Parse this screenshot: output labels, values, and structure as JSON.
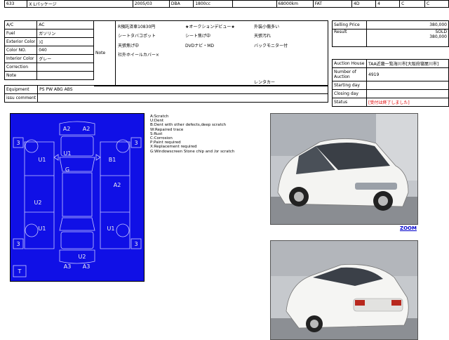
{
  "top_row": [
    "633",
    "X Lパッケージ",
    "2005/03",
    "DBA",
    "1800cc",
    "68000km",
    "FAT",
    "4D",
    "4",
    "C",
    "C"
  ],
  "spec_table": [
    {
      "label": "A/C",
      "value": "AC"
    },
    {
      "label": "Fuel",
      "value": "ガソリン"
    },
    {
      "label": "Exterior Color",
      "value": "ｼﾛ"
    },
    {
      "label": "Color NO.",
      "value": "040"
    },
    {
      "label": "Interior Color",
      "value": "グレー"
    },
    {
      "label": "Correction",
      "value": ""
    },
    {
      "label": "Note",
      "value": ""
    }
  ],
  "note_label": "Note",
  "note_items": [
    "R預託済車10830円",
    "★オークションデビュー★",
    "外装小傷多い",
    "シートタバコポット",
    "シート焦げ中",
    "天張汚れ",
    "天張焦げ中",
    "DVDナビ・MD",
    "バックモニター付",
    "社外ホイールカバー×"
  ],
  "note_extra": "レンタカー",
  "equipment": {
    "label": "Equipment",
    "value": "PS PW ABG ABS"
  },
  "issue_comment": {
    "label": "issu comment",
    "value": ""
  },
  "sale_info": {
    "selling_label": "Selling Price",
    "selling_value": "380,000",
    "result_label": "Result",
    "result_value": "SOLD",
    "result_price": "380,000"
  },
  "auction_info": [
    {
      "label": "Auction House",
      "value": "TAA近畿一覧海川市[大阪府寝屋川市]"
    },
    {
      "label": "Number of Auction",
      "value": "4919"
    },
    {
      "label": "Starting day",
      "value": ""
    },
    {
      "label": "Closing day",
      "value": ""
    },
    {
      "label": "Status",
      "value": "[受付は終了しました]"
    }
  ],
  "damage_labels": {
    "a2_left": "A2",
    "a2_right": "A2",
    "u1_top": "U1",
    "u1_left": "U1",
    "b1_right": "B1",
    "g_center": "G",
    "a2_side": "A2",
    "u2_left": "U2",
    "u1_bottom_left": "U1",
    "u1_bottom_right": "U1",
    "u2_bottom": "U2",
    "a3_left": "A3",
    "a3_right": "A3",
    "n3_tl": "3",
    "n3_tr": "3",
    "n3_bl": "3",
    "n3_br": "3",
    "t_box": "T"
  },
  "legend": [
    "A:Scratch",
    "U:Dent",
    "B:Dent with other defects,deep scratch",
    "W:Repaired trace",
    "S:Rust",
    "C:Corrosion",
    "P:Paint required",
    "X:Replacement required",
    "G:Windowscreen Stone chip and /or scratch"
  ],
  "zoom_label": "ZOOM",
  "colors": {
    "sheet_blue": "#1010e6",
    "status_red": "#e00000",
    "link_blue": "#0000cc"
  }
}
